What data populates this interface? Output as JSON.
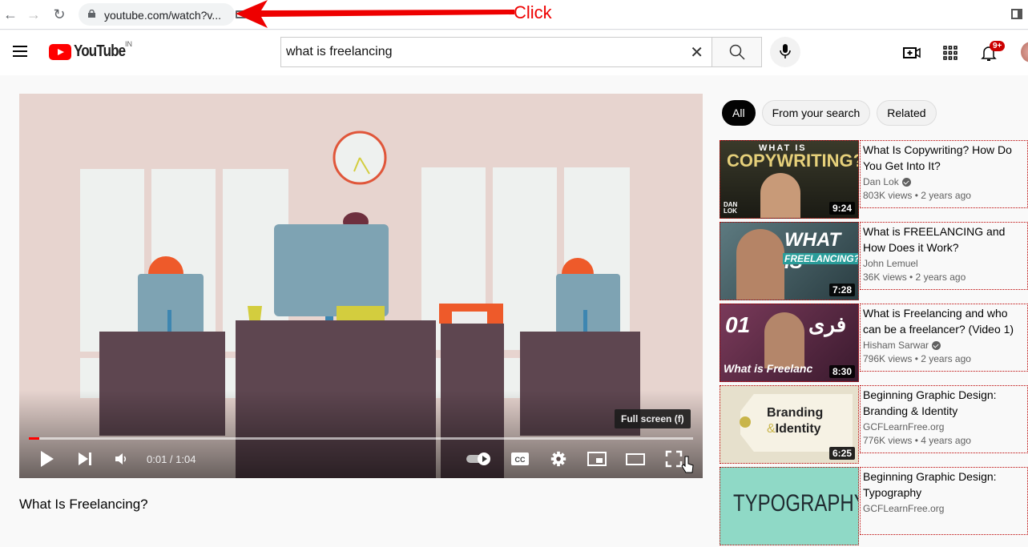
{
  "browser": {
    "url": "youtube.com/watch?v...",
    "annotation_label": "Click",
    "annotation_color": "#e00000"
  },
  "masthead": {
    "logo_text": "YouTube",
    "country_code": "IN",
    "search_value": "what is freelancing",
    "notification_badge": "9+"
  },
  "player": {
    "tooltip": "Full screen (f)",
    "current_time": "0:01",
    "duration": "1:04",
    "time_display": "0:01 / 1:04",
    "progress_fraction": 0.016
  },
  "video": {
    "title": "What Is Freelancing?"
  },
  "chips": [
    {
      "label": "All",
      "active": true
    },
    {
      "label": "From your search",
      "active": false
    },
    {
      "label": "Related",
      "active": false
    }
  ],
  "recommendations": [
    {
      "title": "What Is Copywriting? How Do You Get Into It?",
      "channel": "Dan Lok",
      "verified": true,
      "views": "803K views",
      "age": "2 years ago",
      "meta": "803K views • 2 years ago",
      "duration": "9:24",
      "thumb_text": "WHAT IS COPYWRITING?"
    },
    {
      "title": "What is FREELANCING and How Does it Work?",
      "channel": "John Lemuel",
      "verified": false,
      "views": "36K views",
      "age": "2 years ago",
      "meta": "36K views • 2 years ago",
      "duration": "7:28",
      "thumb_text": "WHAT IS FREELANCING?"
    },
    {
      "title": "What is Freelancing and who can be a freelancer? (Video 1)",
      "channel": "Hisham Sarwar",
      "verified": true,
      "views": "796K views",
      "age": "2 years ago",
      "meta": "796K views • 2 years ago",
      "duration": "8:30",
      "thumb_text": "What is Freelanc"
    },
    {
      "title": "Beginning Graphic Design: Branding & Identity",
      "channel": "GCFLearnFree.org",
      "verified": false,
      "views": "776K views",
      "age": "4 years ago",
      "meta": "776K views • 4 years ago",
      "duration": "6:25",
      "thumb_text": "Branding &Identity"
    },
    {
      "title": "Beginning Graphic Design: Typography",
      "channel": "GCFLearnFree.org",
      "verified": false,
      "views": "",
      "age": "",
      "meta": "",
      "duration": "",
      "thumb_text": "TYPOGRAPHY"
    }
  ]
}
